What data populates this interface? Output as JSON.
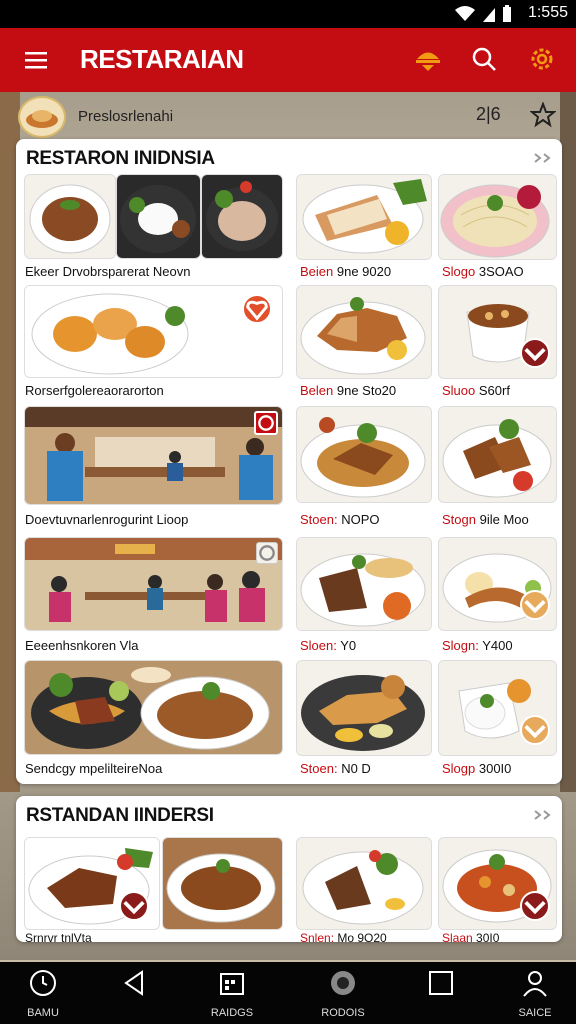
{
  "status": {
    "time": "1:555"
  },
  "appbar": {
    "title": "RESTARAIAN"
  },
  "profile": {
    "name": "Preslosrlenahi",
    "count": "2|6"
  },
  "card1": {
    "header": "RESTARON INIDNSIA",
    "rows": [
      {
        "caption": "Ekeer Drvobrsparerat Neovn",
        "price1": {
          "text": "Beien",
          "suffix": " 9ne 9020"
        },
        "price2": {
          "text": "Slogo",
          "suffix": " 3SOAO"
        }
      },
      {
        "caption": "Rorserfgolereaorarorton",
        "price1": {
          "text": "Belen",
          "suffix": " 9ne Sto20"
        },
        "price2": {
          "text": "Sluoo",
          "suffix": " S60rf"
        }
      },
      {
        "caption": "Doevtuvnarlenrogurint Lioop",
        "price1": {
          "text": "Stoen:",
          "suffix": " NOPO"
        },
        "price2": {
          "text": "Stogn",
          "suffix": " 9ile Moo"
        }
      },
      {
        "caption": "Eeeenhsnkoren Vla",
        "price1": {
          "text": "Sloen:",
          "suffix": " Y0"
        },
        "price2": {
          "text": "Slogn:",
          "suffix": " Y400"
        }
      },
      {
        "caption": "Sendcgy mpelilteireNoa",
        "price1": {
          "text": "Stoen:",
          "suffix": " N0 D"
        },
        "price2": {
          "text": "Slogp",
          "suffix": " 300I0"
        }
      }
    ]
  },
  "card2": {
    "header": "RSTANDAN IINDERSI",
    "row": {
      "caption": "Srnrvr tnlVta",
      "price1": {
        "text": "Snlen:",
        "suffix": " Mo 9O20"
      },
      "price2": {
        "text": "Slaan",
        "suffix": " 30I0"
      }
    }
  },
  "nav": {
    "items": [
      {
        "label": "BAMU"
      },
      {
        "label": ""
      },
      {
        "label": "RAIDGS"
      },
      {
        "label": "RODOIS"
      },
      {
        "label": ""
      },
      {
        "label": "SAICE"
      }
    ]
  },
  "colors": {
    "brand": "#c40d12",
    "accent": "#f29a12",
    "badge": "#8b1a1a"
  }
}
